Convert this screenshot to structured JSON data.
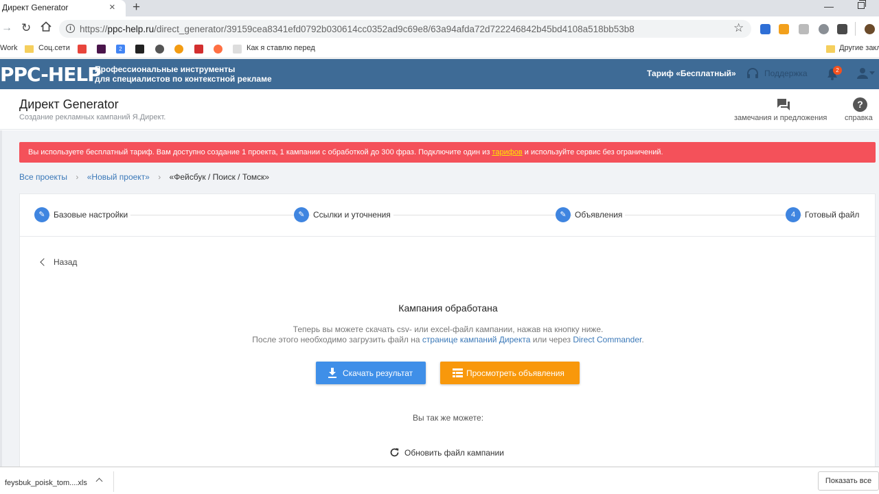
{
  "browser": {
    "tab_title": "Директ Generator",
    "url_prefix": "https://",
    "url_host": "ppc-help.ru",
    "url_path": "/direct_generator/39159cea8341efd0792b030614cc0352ad9c69e8/63a94afda72d722246842b45bd4108a518bb53b8",
    "bookmarks": {
      "work": "Work",
      "social": "Соц.сети",
      "calendar_day": "2",
      "howto": "Как я ставлю перед",
      "other": "Другие закл"
    }
  },
  "header": {
    "logo": "PPC-HELP",
    "tagline_line1": "Профессиональные инструменты",
    "tagline_line2": "для специалистов по контекстной рекламе",
    "tariff": "Тариф «Бесплатный»",
    "support": "Поддержка",
    "notifications_count": "2"
  },
  "page": {
    "title": "Директ Generator",
    "subtitle": "Создание рекламных кампаний Я.Директ.",
    "feedback": "замечания и предложения",
    "help": "справка"
  },
  "alert": {
    "text_before": "Вы используете бесплатный тариф. Вам доступно создание 1 проекта, 1 кампании с обработкой до 300 фраз. Подключите один из ",
    "link": "тарифов",
    "text_after": " и используйте сервис без ограничений."
  },
  "breadcrumb": {
    "all_projects": "Все проекты",
    "new_project": "«Новый проект»",
    "current": "«Фейсбук / Поиск / Томск»"
  },
  "steps": [
    {
      "label": "Базовые настройки",
      "marker": "✎"
    },
    {
      "label": "Ссылки и уточнения",
      "marker": "✎"
    },
    {
      "label": "Объявления",
      "marker": "✎"
    },
    {
      "label": "Готовый файл",
      "marker": "4"
    }
  ],
  "result": {
    "back": "Назад",
    "title": "Кампания обработана",
    "desc_line1": "Теперь вы можете скачать csv- или excel-файл кампании, нажав на кнопку ниже.",
    "desc_line2_before": "После этого необходимо загрузить файл на ",
    "desc_link1": "странице кампаний Директа",
    "desc_mid": " или через ",
    "desc_link2": "Direct Commander",
    "desc_end": ".",
    "download_button": "Скачать результат",
    "view_button": "Просмотреть объявления",
    "also": "Вы так же можете:",
    "refresh": "Обновить файл кампании"
  },
  "downloads": {
    "file": "feysbuk_poisk_tom....xls",
    "show_all": "Показать все"
  },
  "colors": {
    "header_bg": "#3e6b96",
    "alert_bg": "#f4515a",
    "download_btn": "#3f8fe8",
    "view_btn": "#f8980b",
    "step_circle": "#3f85e0",
    "link": "#3a78b8"
  }
}
